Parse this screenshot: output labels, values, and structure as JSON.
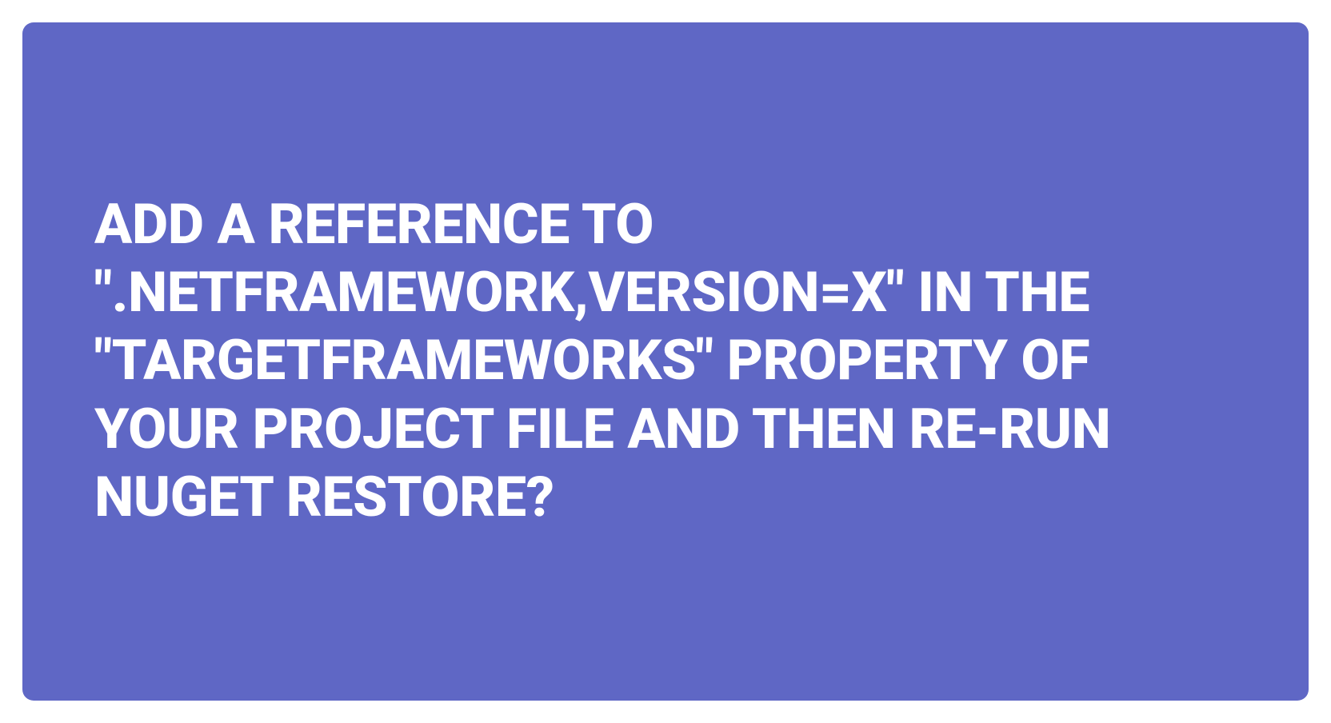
{
  "card": {
    "text": "ADD A REFERENCE TO \".NETFRAMEWORK,VERSION=X\" IN THE \"TARGETFRAMEWORKS\" PROPERTY OF YOUR PROJECT FILE AND THEN RE-RUN NUGET RESTORE?",
    "background_color": "#5f67c5",
    "text_color": "#ffffff"
  }
}
